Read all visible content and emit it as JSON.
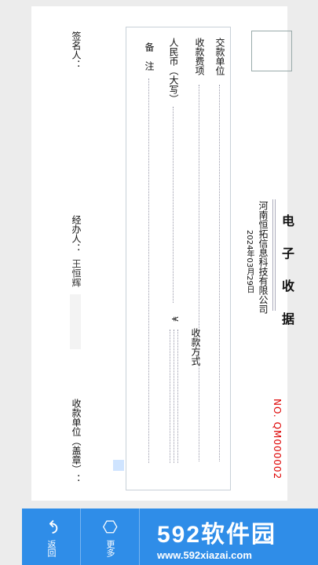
{
  "receipt": {
    "title": "电 子 收 据",
    "company": "河南恒拓信息科技有限公司",
    "date": "2024年03月29日",
    "serial": "NO. QM000002",
    "payer_label": "交款单位",
    "item_label": "收款费项",
    "amount_label": "人民币（大写）",
    "note_label": "备　注",
    "currency_symbol": "¥",
    "payment_method_label": "收款方式",
    "signer_label": "签名人：",
    "handler_label": "经办人：",
    "handler_name": "王恒辉",
    "seal_label": "收款单位（盖章）："
  },
  "toolbar": {
    "back_label": "返回",
    "more_label": "更多"
  },
  "watermark": {
    "logo": "592软件园",
    "url": "www.592xiazai.com"
  }
}
